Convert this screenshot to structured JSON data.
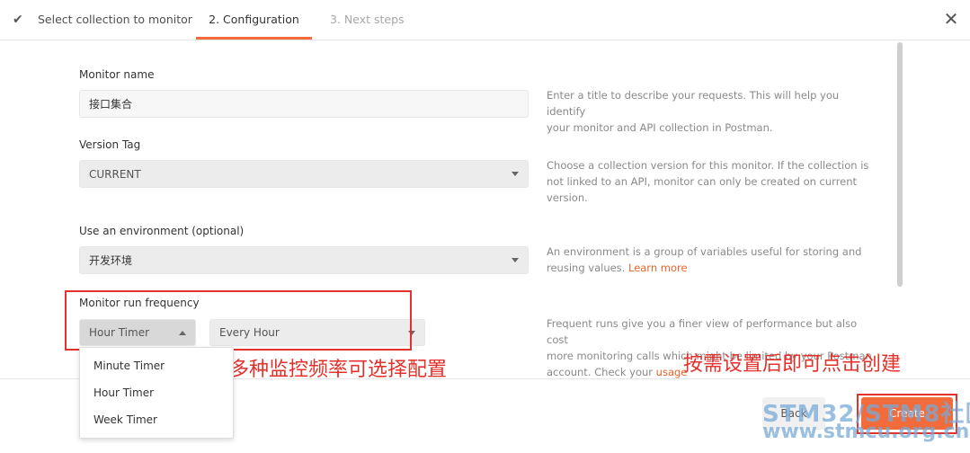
{
  "steps": {
    "step1": "Select collection to monitor",
    "step2": "2. Configuration",
    "step3": "3. Next steps"
  },
  "close_icon": "close-icon",
  "form": {
    "monitor_name": {
      "label": "Monitor name",
      "value": "接口集合",
      "help": [
        "Enter a title to describe your requests. This will help you identify",
        "your monitor and API collection in Postman."
      ]
    },
    "version_tag": {
      "label": "Version Tag",
      "value": "CURRENT",
      "help": [
        "Choose a collection version for this monitor. If the collection is",
        "not linked to an API, monitor can only be created on current",
        "version."
      ]
    },
    "environment": {
      "label": "Use an environment (optional)",
      "value": "开发环境",
      "help_line1": "An environment is a group of variables useful for storing and",
      "help_line2_text": "reusing values.",
      "help_link": "Learn more"
    },
    "frequency": {
      "label": "Monitor run frequency",
      "timer_value": "Hour Timer",
      "interval_value": "Every Hour",
      "help_line1": "Frequent runs give you a finer view of performance but also cost",
      "help_line2": "more monitoring calls which might be limited by your Postman",
      "help_line3_text": "account. Check your",
      "help_link": "usage"
    }
  },
  "timer_options": [
    "Minute Timer",
    "Hour Timer",
    "Week Timer"
  ],
  "annotations": {
    "left": "有多种监控频率可选择配置",
    "right": "按需设置后即可点击创建"
  },
  "footer": {
    "back_label": "Back",
    "create_label": "Create"
  },
  "watermark": {
    "line1": "STM32/STM8社区",
    "line2": "www.stmcu.org.cn"
  },
  "colors": {
    "accent": "#f26b3a",
    "annotation_red": "#e3312b"
  }
}
